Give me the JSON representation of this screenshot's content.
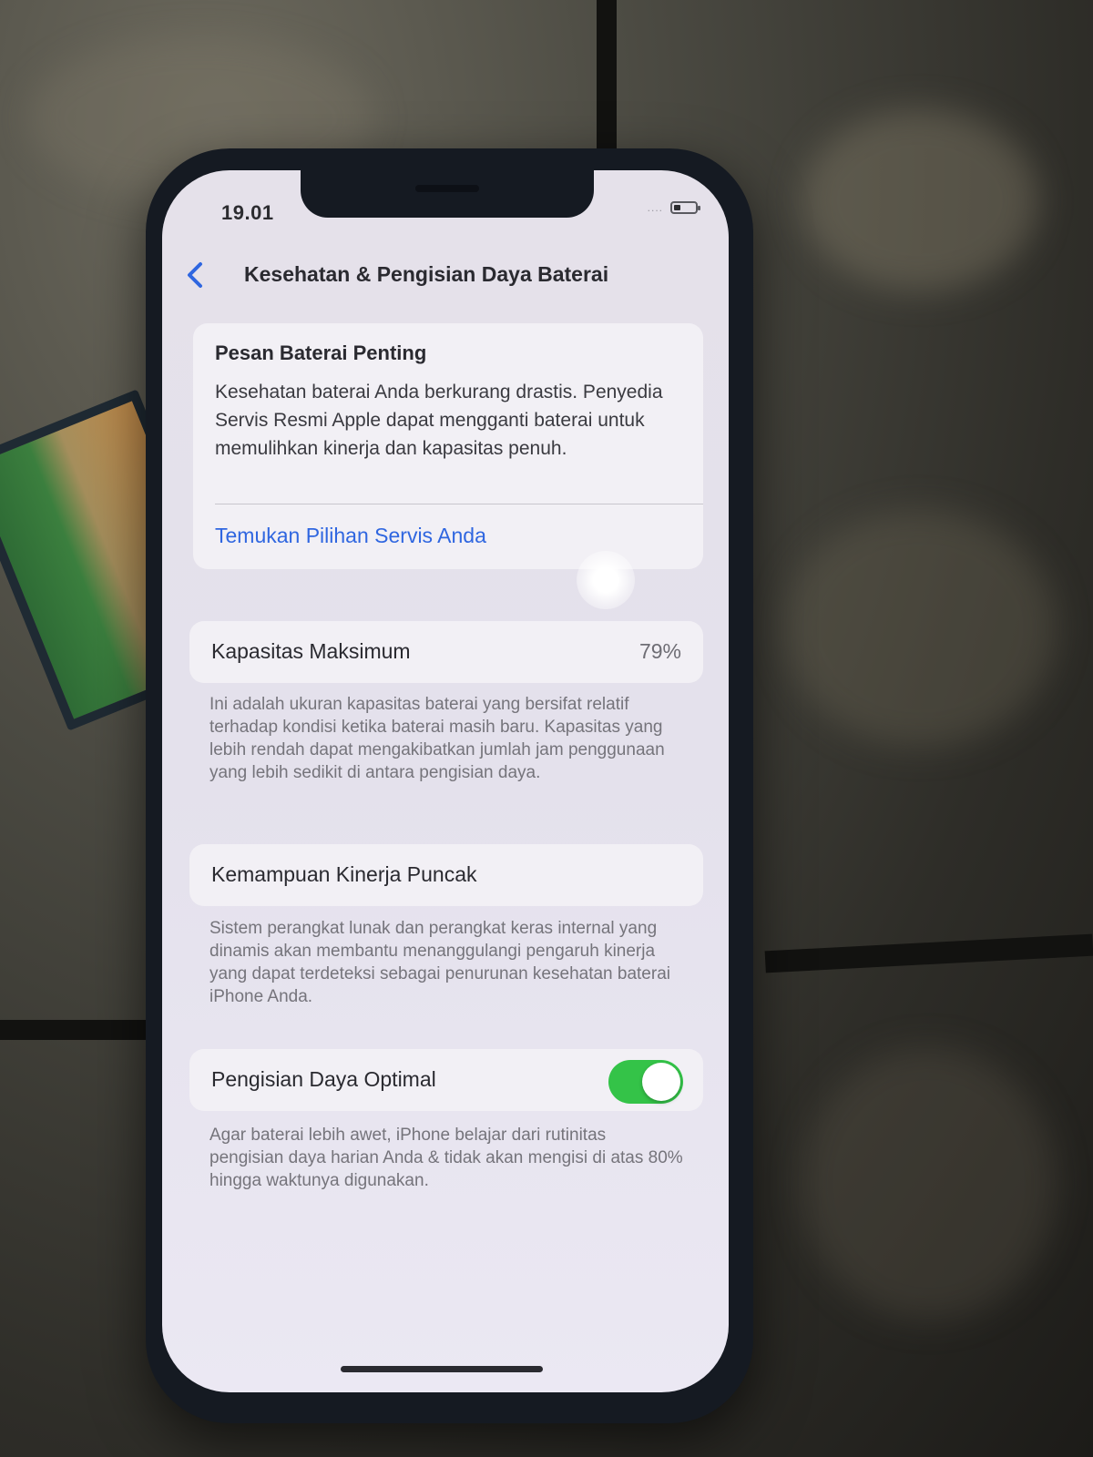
{
  "status_bar": {
    "time": "19.01",
    "signal": "....",
    "battery_level": 0.3
  },
  "nav": {
    "back_icon": "chevron-left-icon",
    "title": "Kesehatan & Pengisian Daya Baterai"
  },
  "alert": {
    "title": "Pesan Baterai Penting",
    "body": "Kesehatan baterai Anda berkurang drastis. Penyedia Servis Resmi Apple dapat mengganti baterai untuk memulihkan kinerja dan kapasitas penuh.",
    "link": "Temukan Pilihan Servis Anda"
  },
  "capacity": {
    "label": "Kapasitas Maksimum",
    "value": "79%",
    "footnote": "Ini adalah ukuran kapasitas baterai yang bersifat relatif terhadap kondisi ketika baterai masih baru. Kapasitas yang lebih rendah dapat mengakibatkan jumlah jam penggunaan yang lebih sedikit di antara pengisian daya."
  },
  "peak": {
    "label": "Kemampuan Kinerja Puncak",
    "footnote": "Sistem perangkat lunak dan perangkat keras internal yang dinamis akan membantu menanggulangi pengaruh kinerja yang dapat terdeteksi sebagai penurunan kesehatan baterai iPhone Anda."
  },
  "optimized_charging": {
    "label": "Pengisian Daya Optimal",
    "enabled": true,
    "footnote": "Agar baterai lebih awet, iPhone belajar dari rutinitas pengisian daya harian Anda & tidak akan mengisi di atas 80% hingga waktunya digunakan."
  },
  "colors": {
    "accent": "#2f66e0",
    "toggle_on": "#34c348"
  }
}
